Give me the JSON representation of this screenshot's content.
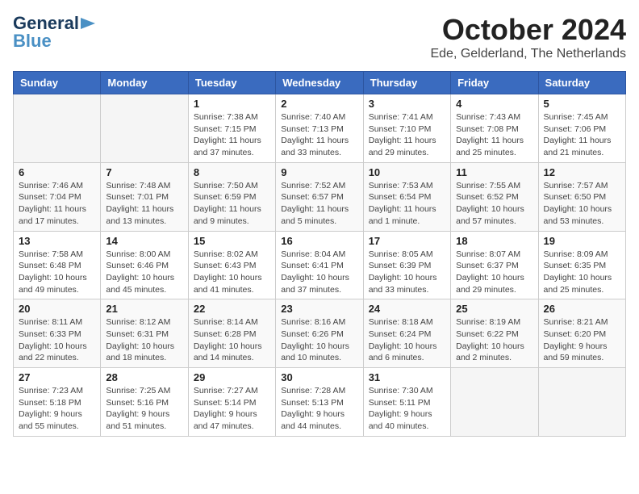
{
  "logo": {
    "line1": "General",
    "line2": "Blue"
  },
  "title": "October 2024",
  "subtitle": "Ede, Gelderland, The Netherlands",
  "days_of_week": [
    "Sunday",
    "Monday",
    "Tuesday",
    "Wednesday",
    "Thursday",
    "Friday",
    "Saturday"
  ],
  "weeks": [
    [
      {
        "day": "",
        "detail": ""
      },
      {
        "day": "",
        "detail": ""
      },
      {
        "day": "1",
        "detail": "Sunrise: 7:38 AM\nSunset: 7:15 PM\nDaylight: 11 hours and 37 minutes."
      },
      {
        "day": "2",
        "detail": "Sunrise: 7:40 AM\nSunset: 7:13 PM\nDaylight: 11 hours and 33 minutes."
      },
      {
        "day": "3",
        "detail": "Sunrise: 7:41 AM\nSunset: 7:10 PM\nDaylight: 11 hours and 29 minutes."
      },
      {
        "day": "4",
        "detail": "Sunrise: 7:43 AM\nSunset: 7:08 PM\nDaylight: 11 hours and 25 minutes."
      },
      {
        "day": "5",
        "detail": "Sunrise: 7:45 AM\nSunset: 7:06 PM\nDaylight: 11 hours and 21 minutes."
      }
    ],
    [
      {
        "day": "6",
        "detail": "Sunrise: 7:46 AM\nSunset: 7:04 PM\nDaylight: 11 hours and 17 minutes."
      },
      {
        "day": "7",
        "detail": "Sunrise: 7:48 AM\nSunset: 7:01 PM\nDaylight: 11 hours and 13 minutes."
      },
      {
        "day": "8",
        "detail": "Sunrise: 7:50 AM\nSunset: 6:59 PM\nDaylight: 11 hours and 9 minutes."
      },
      {
        "day": "9",
        "detail": "Sunrise: 7:52 AM\nSunset: 6:57 PM\nDaylight: 11 hours and 5 minutes."
      },
      {
        "day": "10",
        "detail": "Sunrise: 7:53 AM\nSunset: 6:54 PM\nDaylight: 11 hours and 1 minute."
      },
      {
        "day": "11",
        "detail": "Sunrise: 7:55 AM\nSunset: 6:52 PM\nDaylight: 10 hours and 57 minutes."
      },
      {
        "day": "12",
        "detail": "Sunrise: 7:57 AM\nSunset: 6:50 PM\nDaylight: 10 hours and 53 minutes."
      }
    ],
    [
      {
        "day": "13",
        "detail": "Sunrise: 7:58 AM\nSunset: 6:48 PM\nDaylight: 10 hours and 49 minutes."
      },
      {
        "day": "14",
        "detail": "Sunrise: 8:00 AM\nSunset: 6:46 PM\nDaylight: 10 hours and 45 minutes."
      },
      {
        "day": "15",
        "detail": "Sunrise: 8:02 AM\nSunset: 6:43 PM\nDaylight: 10 hours and 41 minutes."
      },
      {
        "day": "16",
        "detail": "Sunrise: 8:04 AM\nSunset: 6:41 PM\nDaylight: 10 hours and 37 minutes."
      },
      {
        "day": "17",
        "detail": "Sunrise: 8:05 AM\nSunset: 6:39 PM\nDaylight: 10 hours and 33 minutes."
      },
      {
        "day": "18",
        "detail": "Sunrise: 8:07 AM\nSunset: 6:37 PM\nDaylight: 10 hours and 29 minutes."
      },
      {
        "day": "19",
        "detail": "Sunrise: 8:09 AM\nSunset: 6:35 PM\nDaylight: 10 hours and 25 minutes."
      }
    ],
    [
      {
        "day": "20",
        "detail": "Sunrise: 8:11 AM\nSunset: 6:33 PM\nDaylight: 10 hours and 22 minutes."
      },
      {
        "day": "21",
        "detail": "Sunrise: 8:12 AM\nSunset: 6:31 PM\nDaylight: 10 hours and 18 minutes."
      },
      {
        "day": "22",
        "detail": "Sunrise: 8:14 AM\nSunset: 6:28 PM\nDaylight: 10 hours and 14 minutes."
      },
      {
        "day": "23",
        "detail": "Sunrise: 8:16 AM\nSunset: 6:26 PM\nDaylight: 10 hours and 10 minutes."
      },
      {
        "day": "24",
        "detail": "Sunrise: 8:18 AM\nSunset: 6:24 PM\nDaylight: 10 hours and 6 minutes."
      },
      {
        "day": "25",
        "detail": "Sunrise: 8:19 AM\nSunset: 6:22 PM\nDaylight: 10 hours and 2 minutes."
      },
      {
        "day": "26",
        "detail": "Sunrise: 8:21 AM\nSunset: 6:20 PM\nDaylight: 9 hours and 59 minutes."
      }
    ],
    [
      {
        "day": "27",
        "detail": "Sunrise: 7:23 AM\nSunset: 5:18 PM\nDaylight: 9 hours and 55 minutes."
      },
      {
        "day": "28",
        "detail": "Sunrise: 7:25 AM\nSunset: 5:16 PM\nDaylight: 9 hours and 51 minutes."
      },
      {
        "day": "29",
        "detail": "Sunrise: 7:27 AM\nSunset: 5:14 PM\nDaylight: 9 hours and 47 minutes."
      },
      {
        "day": "30",
        "detail": "Sunrise: 7:28 AM\nSunset: 5:13 PM\nDaylight: 9 hours and 44 minutes."
      },
      {
        "day": "31",
        "detail": "Sunrise: 7:30 AM\nSunset: 5:11 PM\nDaylight: 9 hours and 40 minutes."
      },
      {
        "day": "",
        "detail": ""
      },
      {
        "day": "",
        "detail": ""
      }
    ]
  ]
}
